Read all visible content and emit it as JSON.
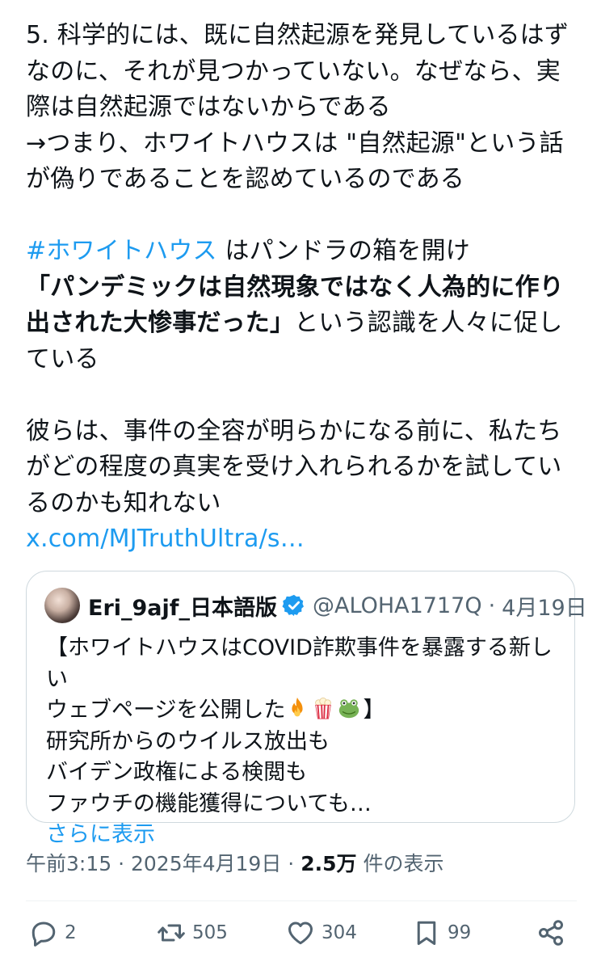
{
  "tweet": {
    "lines_p1": [
      "5. 科学的には、既に自然起源を発見しているはず",
      "なのに、それが見つかっていない。なぜなら、実",
      "際は自然起源ではないからである",
      "→つまり、ホワイトハウスは \"自然起源\"という話",
      "が偽りであることを認めているのである"
    ],
    "hashtag": "#ホワイトハウス",
    "p2_after_hashtag": " はパンドラの箱を開け",
    "p2_bold_line1": "「パンデミックは自然現象ではなく人為的に作り",
    "p2_bold_line2": "出された大惨事だった」",
    "p2_line2_rest": "という認識を人々に促し",
    "p2_line3": "ている",
    "lines_p3": [
      "彼らは、事件の全容が明らかになる前に、私たち",
      "がどの程度の真実を受け入れられるかを試してい",
      "るのかも知れない"
    ],
    "link": "x.com/MJTruthUltra/s…"
  },
  "quote": {
    "name": "Eri_9ajf_日本語版",
    "handle": "@ALOHA1717Q",
    "separator": "·",
    "date": "4月19日",
    "line1": "【ホワイトハウスはCOVID詐欺事件を暴露する新しい",
    "line2_text": "ウェブページを公開した",
    "line2_end": "】",
    "emojis": [
      "fire-emoji",
      "popcorn-emoji",
      "frog-emoji"
    ],
    "line3": "研究所からのウイルス放出も",
    "line4": "バイデン政権による検閲も",
    "line5": "ファウチの機能獲得についても…",
    "show_more": "さらに表示"
  },
  "meta": {
    "time": "午前3:15",
    "separator": "·",
    "date": "2025年4月19日",
    "views_count": "2.5万",
    "views_label": " 件の表示"
  },
  "actions": {
    "replies": "2",
    "retweets": "505",
    "likes": "304",
    "bookmarks": "99"
  },
  "colors": {
    "accent": "#1d9bf0",
    "text": "#0f1419",
    "secondary": "#536471",
    "border": "#cfd9de"
  }
}
